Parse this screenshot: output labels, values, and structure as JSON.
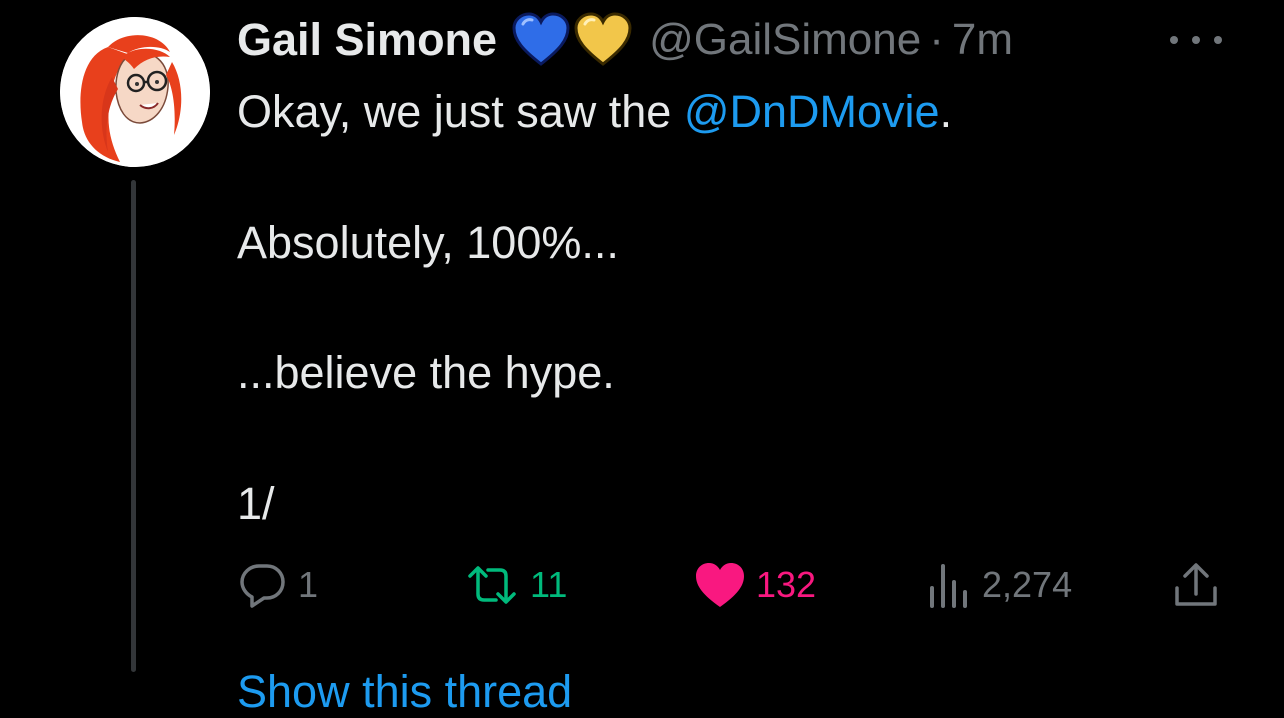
{
  "author": {
    "name": "Gail Simone",
    "emoji": [
      "blue-heart",
      "yellow-heart"
    ],
    "handle": "@GailSimone",
    "separator": "·",
    "time": "7m"
  },
  "tweet": {
    "line1_prefix": "Okay, we just saw the ",
    "line1_mention": "@DnDMovie",
    "line1_suffix": ".",
    "line2": "Absolutely, 100%...",
    "line3": "...believe the hype.",
    "line4": "1/"
  },
  "actions": {
    "replies": "1",
    "retweets": "11",
    "likes": "132",
    "views": "2,274"
  },
  "footer": {
    "show_thread": "Show this thread"
  },
  "colors": {
    "background": "#000000",
    "text": "#e7e9ea",
    "muted": "#71767b",
    "link": "#1d9bf0",
    "retweet": "#00ba7c",
    "like": "#f91880",
    "avatar_hair": "#e8401c"
  }
}
